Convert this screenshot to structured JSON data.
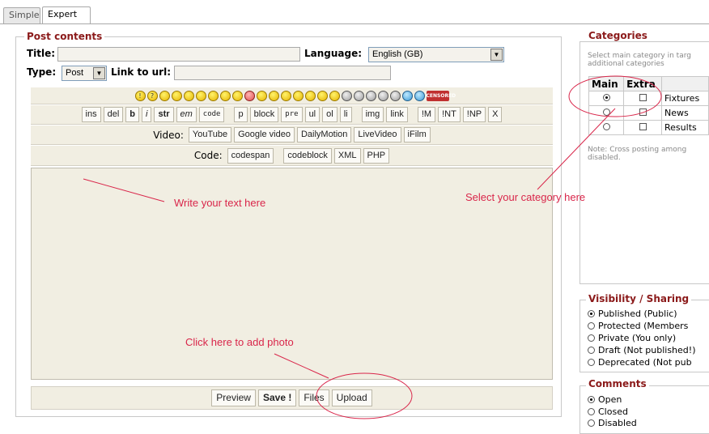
{
  "tabs": [
    {
      "label": "Simple"
    },
    {
      "label": "Expert"
    }
  ],
  "post": {
    "legend": "Post contents",
    "title_label": "Title:",
    "language_label": "Language:",
    "language_value": "English (GB)",
    "type_label": "Type:",
    "type_value": "Post",
    "link_label": "Link to url:"
  },
  "format_buttons": [
    "ins",
    "del",
    "b",
    "i",
    "str",
    "em",
    "code",
    "p",
    "block",
    "pre",
    "ul",
    "ol",
    "li",
    "img",
    "link",
    "!M",
    "!NT",
    "!NP",
    "X"
  ],
  "video": {
    "label": "Video:",
    "buttons": [
      "YouTube",
      "Google video",
      "DailyMotion",
      "LiveVideo",
      "iFilm"
    ]
  },
  "code": {
    "label": "Code:",
    "buttons": [
      "codespan",
      "codeblock",
      "XML",
      "PHP"
    ]
  },
  "bottom_buttons": {
    "preview": "Preview",
    "save": "Save !",
    "files": "Files",
    "upload": "Upload"
  },
  "annotations": {
    "write": "Write your text here",
    "category": "Select your category here",
    "photo": "Click here to add photo"
  },
  "annotation_color": "#d9264a",
  "categories": {
    "legend": "Categories",
    "help": "Select main category in targ additional categories",
    "col_main": "Main",
    "col_extra": "Extra",
    "rows": [
      {
        "name": "Fixtures",
        "main": true
      },
      {
        "name": "News",
        "main": false
      },
      {
        "name": "Results",
        "main": false
      }
    ],
    "note": "Note: Cross posting among disabled."
  },
  "visibility": {
    "legend": "Visibility / Sharing",
    "options": [
      {
        "label": "Published (Public)",
        "selected": true
      },
      {
        "label": "Protected (Members",
        "selected": false
      },
      {
        "label": "Private (You only)",
        "selected": false
      },
      {
        "label": "Draft (Not published!)",
        "selected": false
      },
      {
        "label": "Deprecated (Not pub",
        "selected": false
      }
    ]
  },
  "comments": {
    "legend": "Comments",
    "options": [
      {
        "label": "Open",
        "selected": true
      },
      {
        "label": "Closed",
        "selected": false
      },
      {
        "label": "Disabled",
        "selected": false
      }
    ]
  },
  "legend_color": "#8b1a1a"
}
